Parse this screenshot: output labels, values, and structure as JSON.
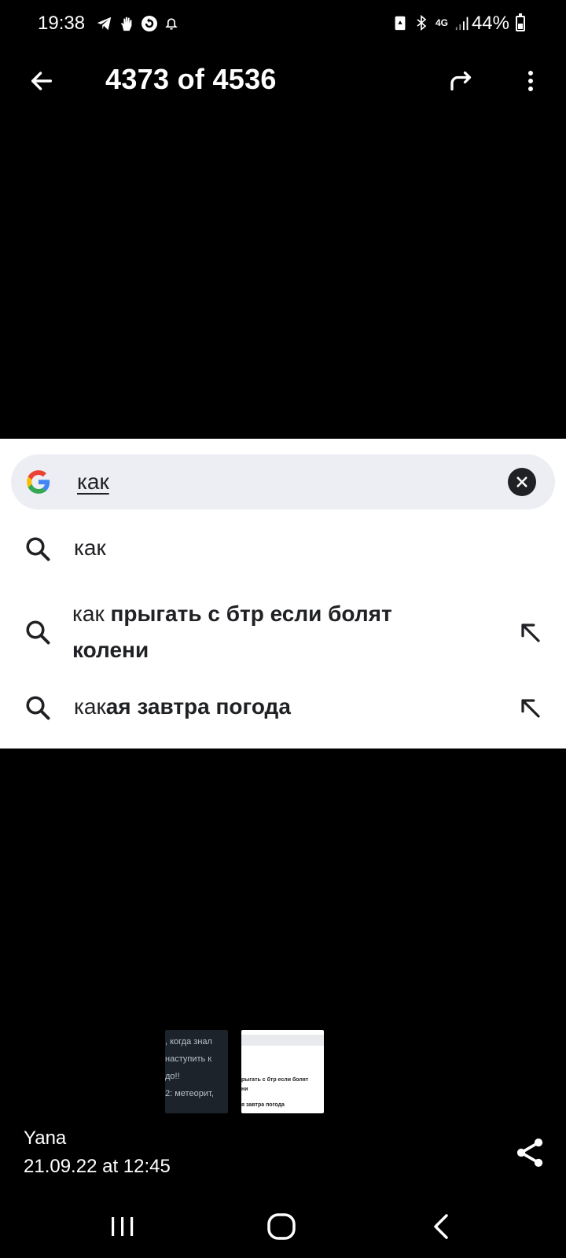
{
  "status_bar": {
    "time": "19:38",
    "battery": "44%",
    "battery_level": 0.44,
    "network": "4G",
    "left_icons": [
      "telegram-icon",
      "hand-icon",
      "sync-icon",
      "notification-bell-icon"
    ],
    "right_icons": [
      "battery-saver-icon",
      "bluetooth-icon",
      "network-4g-icon",
      "signal-icon"
    ]
  },
  "top_bar": {
    "counter": "4373 of 4536"
  },
  "screenshot": {
    "search_query": "как",
    "suggestions": [
      {
        "prefix": "как",
        "bold": ""
      },
      {
        "prefix": "как ",
        "bold": "прыгать с бтр если болят",
        "bold_line2": "колени"
      },
      {
        "prefix": "как",
        "bold": "ая завтра погода"
      }
    ]
  },
  "thumbnails": {
    "thumb1_lines": [
      ", когда знал",
      "наступить к",
      "до!!",
      "2: метеорит,"
    ],
    "thumb2_lines": [
      "рыгать с бтр если болят",
      "ни",
      "я завтра погода"
    ]
  },
  "info": {
    "sender": "Yana",
    "date": "21.09.22 at 12:45"
  },
  "colors": {
    "background": "#000000",
    "search_box": "#eceef3",
    "text_dark": "#202124"
  }
}
